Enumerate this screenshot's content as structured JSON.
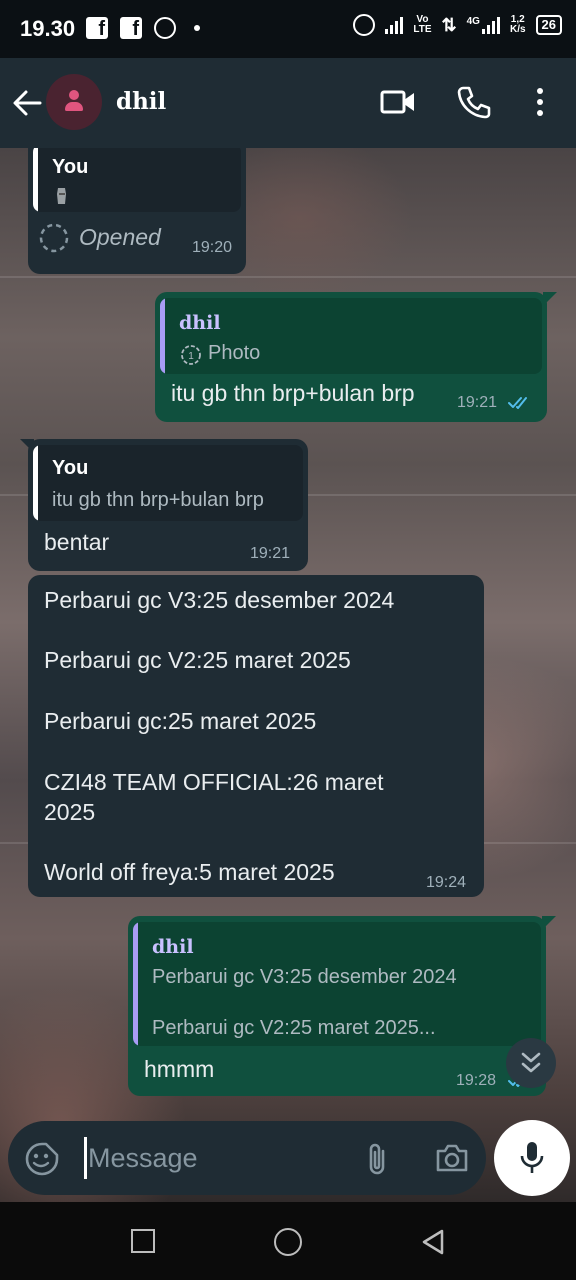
{
  "status_bar": {
    "time": "19.30",
    "net_speed_value": "1,2",
    "net_speed_unit": "K/s",
    "network_type": "4G",
    "volte_top": "Vo",
    "volte_bottom": "LTE",
    "battery": "26"
  },
  "header": {
    "contact_name": "dhil"
  },
  "messages": [
    {
      "quote_author": "You",
      "quote_icon": "moai-emoji",
      "status_text": "Opened",
      "time": "19:20"
    },
    {
      "quote_author": "dhil",
      "quote_text": "Photo",
      "text": "itu gb thn brp+bulan brp",
      "time": "19:21"
    },
    {
      "quote_author": "You",
      "quote_text": "itu gb thn brp+bulan brp",
      "text": "bentar",
      "time": "19:21"
    },
    {
      "lines": [
        "Perbarui gc V3:25 desember 2024",
        "Perbarui gc V2:25 maret 2025",
        "Perbarui gc:25 maret 2025",
        "CZI48 TEAM OFFICIAL:26 maret",
        "2025",
        "World off freya:5 maret 2025"
      ],
      "time": "19:24"
    },
    {
      "quote_author": "dhil",
      "quote_line1": "Perbarui gc V3:25 desember 2024",
      "quote_line2": "Perbarui gc V2:25 maret 2025...",
      "text": "hmmm",
      "time": "19:28"
    }
  ],
  "input": {
    "placeholder": "Message"
  },
  "colors": {
    "incoming_bubble": "#1f2c34",
    "outgoing_bubble": "#10503e",
    "read_ticks": "#53bdeb",
    "quote_bar_dhil": "#a99cf5"
  }
}
